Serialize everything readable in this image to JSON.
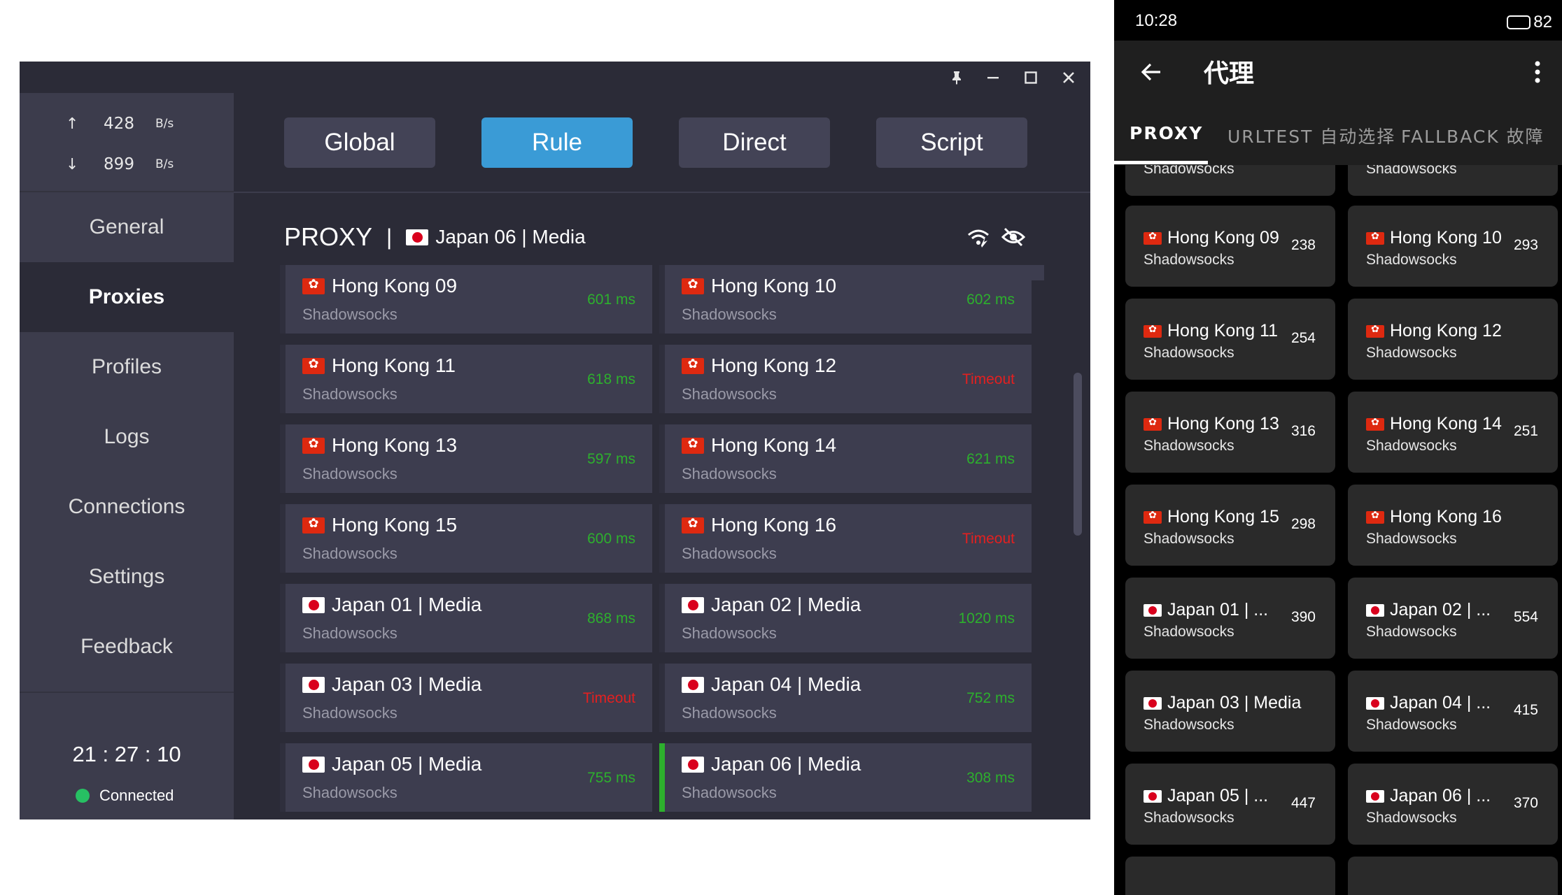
{
  "colors": {
    "accent": "#3a9bd6",
    "ok": "#2db02d",
    "timeout": "#e32020",
    "connected": "#27c063"
  },
  "window": {
    "titlebar_buttons": [
      "pin-icon",
      "minimize-icon",
      "maximize-icon",
      "close-icon"
    ]
  },
  "traffic": {
    "up": {
      "arrow": "↑",
      "value": "428",
      "unit": "B/s"
    },
    "down": {
      "arrow": "↓",
      "value": "899",
      "unit": "B/s"
    }
  },
  "nav": [
    "General",
    "Proxies",
    "Profiles",
    "Logs",
    "Connections",
    "Settings",
    "Feedback"
  ],
  "nav_active": "Proxies",
  "clock": "21 : 27 : 10",
  "status": "Connected",
  "modes": [
    "Global",
    "Rule",
    "Direct",
    "Script"
  ],
  "mode_active": "Rule",
  "group": {
    "name": "PROXY",
    "sep": "|",
    "selected": "Japan 06 | Media",
    "selected_flag": "jp"
  },
  "proxies": [
    {
      "flag": "hk",
      "name": "Hong Kong 09",
      "type": "Shadowsocks",
      "delay": "601 ms",
      "ok": true
    },
    {
      "flag": "hk",
      "name": "Hong Kong 10",
      "type": "Shadowsocks",
      "delay": "602 ms",
      "ok": true
    },
    {
      "flag": "hk",
      "name": "Hong Kong 11",
      "type": "Shadowsocks",
      "delay": "618 ms",
      "ok": true
    },
    {
      "flag": "hk",
      "name": "Hong Kong 12",
      "type": "Shadowsocks",
      "delay": "Timeout",
      "ok": false
    },
    {
      "flag": "hk",
      "name": "Hong Kong 13",
      "type": "Shadowsocks",
      "delay": "597 ms",
      "ok": true
    },
    {
      "flag": "hk",
      "name": "Hong Kong 14",
      "type": "Shadowsocks",
      "delay": "621 ms",
      "ok": true
    },
    {
      "flag": "hk",
      "name": "Hong Kong 15",
      "type": "Shadowsocks",
      "delay": "600 ms",
      "ok": true
    },
    {
      "flag": "hk",
      "name": "Hong Kong 16",
      "type": "Shadowsocks",
      "delay": "Timeout",
      "ok": false
    },
    {
      "flag": "jp",
      "name": "Japan 01 | Media",
      "type": "Shadowsocks",
      "delay": "868 ms",
      "ok": true
    },
    {
      "flag": "jp",
      "name": "Japan 02 | Media",
      "type": "Shadowsocks",
      "delay": "1020 ms",
      "ok": true
    },
    {
      "flag": "jp",
      "name": "Japan 03 | Media",
      "type": "Shadowsocks",
      "delay": "Timeout",
      "ok": false
    },
    {
      "flag": "jp",
      "name": "Japan 04 | Media",
      "type": "Shadowsocks",
      "delay": "752 ms",
      "ok": true
    },
    {
      "flag": "jp",
      "name": "Japan 05 | Media",
      "type": "Shadowsocks",
      "delay": "755 ms",
      "ok": true
    },
    {
      "flag": "jp",
      "name": "Japan 06 | Media",
      "type": "Shadowsocks",
      "delay": "308 ms",
      "ok": true,
      "selected": true
    }
  ],
  "mobile": {
    "time": "10:28",
    "battery": "82",
    "battery_level": 0.82,
    "title": "代理",
    "tabs": [
      "PROXY",
      "URLTEST 自动选择",
      "FALLBACK 故障"
    ],
    "tab_active": "PROXY",
    "top_partial": [
      {
        "type": "Shadowsocks"
      },
      {
        "type": "Shadowsocks"
      }
    ],
    "cards": [
      {
        "flag": "hk",
        "name": "Hong Kong 09",
        "type": "Shadowsocks",
        "delay": "238"
      },
      {
        "flag": "hk",
        "name": "Hong Kong 10",
        "type": "Shadowsocks",
        "delay": "293"
      },
      {
        "flag": "hk",
        "name": "Hong Kong 11",
        "type": "Shadowsocks",
        "delay": "254"
      },
      {
        "flag": "hk",
        "name": "Hong Kong 12",
        "type": "Shadowsocks",
        "delay": ""
      },
      {
        "flag": "hk",
        "name": "Hong Kong 13",
        "type": "Shadowsocks",
        "delay": "316"
      },
      {
        "flag": "hk",
        "name": "Hong Kong 14",
        "type": "Shadowsocks",
        "delay": "251"
      },
      {
        "flag": "hk",
        "name": "Hong Kong 15",
        "type": "Shadowsocks",
        "delay": "298"
      },
      {
        "flag": "hk",
        "name": "Hong Kong 16",
        "type": "Shadowsocks",
        "delay": ""
      },
      {
        "flag": "jp",
        "name": "Japan 01 | ...",
        "type": "Shadowsocks",
        "delay": "390"
      },
      {
        "flag": "jp",
        "name": "Japan 02 | ...",
        "type": "Shadowsocks",
        "delay": "554"
      },
      {
        "flag": "jp",
        "name": "Japan 03 | Media",
        "type": "Shadowsocks",
        "delay": ""
      },
      {
        "flag": "jp",
        "name": "Japan 04 | ...",
        "type": "Shadowsocks",
        "delay": "415"
      },
      {
        "flag": "jp",
        "name": "Japan 05 | ...",
        "type": "Shadowsocks",
        "delay": "447"
      },
      {
        "flag": "jp",
        "name": "Japan 06 | ...",
        "type": "Shadowsocks",
        "delay": "370"
      }
    ]
  }
}
